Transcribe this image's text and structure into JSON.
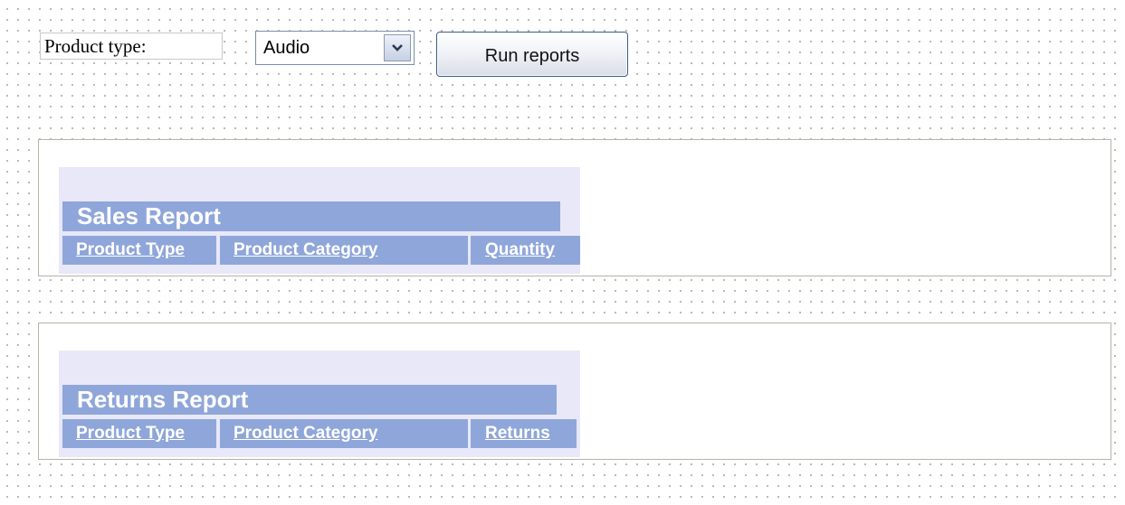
{
  "toolbar": {
    "product_type_label": "Product type:",
    "product_type_select": {
      "value": "Audio"
    },
    "run_button_label": "Run reports"
  },
  "reports": {
    "sales": {
      "title": "Sales Report",
      "columns": [
        "Product Type",
        "Product Category",
        "Quantity"
      ]
    },
    "returns": {
      "title": "Returns Report",
      "columns": [
        "Product Type",
        "Product Category",
        "Returns"
      ]
    }
  }
}
